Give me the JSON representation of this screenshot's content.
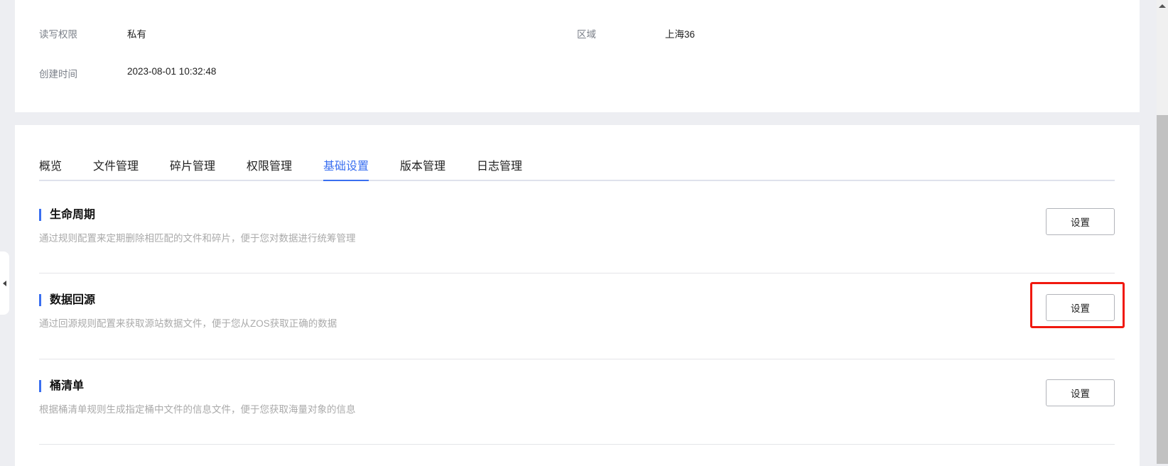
{
  "info": {
    "rw_label": "读写权限",
    "rw_value": "私有",
    "region_label": "区域",
    "region_value": "上海36",
    "created_label": "创建时间",
    "created_value": "2023-08-01 10:32:48"
  },
  "tabs": [
    "概览",
    "文件管理",
    "碎片管理",
    "权限管理",
    "基础设置",
    "版本管理",
    "日志管理"
  ],
  "active_tab": "基础设置",
  "sections": [
    {
      "title": "生命周期",
      "desc": "通过规则配置来定期删除相匹配的文件和碎片，便于您对数据进行统筹管理",
      "button": "设置"
    },
    {
      "title": "数据回源",
      "desc": "通过回源规则配置来获取源站数据文件，便于您从ZOS获取正确的数据",
      "button": "设置"
    },
    {
      "title": "桶清单",
      "desc": "根据桶清单规则生成指定桶中文件的信息文件，便于您获取海量对象的信息",
      "button": "设置"
    }
  ],
  "colors": {
    "accent": "#3a6ff0",
    "highlight": "#f0190f"
  }
}
